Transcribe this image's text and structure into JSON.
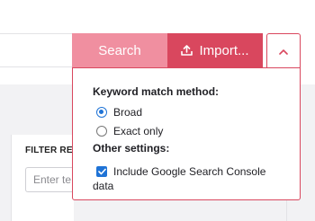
{
  "toolbar": {
    "search_label": "Search",
    "import_label": "Import...",
    "accent": "#d9475e",
    "search_color": "#f08fa0"
  },
  "filter": {
    "label": "FILTER RES",
    "input_placeholder": "Enter te"
  },
  "dropdown": {
    "match_heading": "Keyword match method:",
    "options": [
      {
        "label": "Broad",
        "selected": true
      },
      {
        "label": "Exact only",
        "selected": false
      }
    ],
    "other_heading": "Other settings:",
    "gsc_label_line1": "Include Google Search Console",
    "gsc_label_line2": "data",
    "gsc_checked": true,
    "check_color": "#1f73d6"
  }
}
